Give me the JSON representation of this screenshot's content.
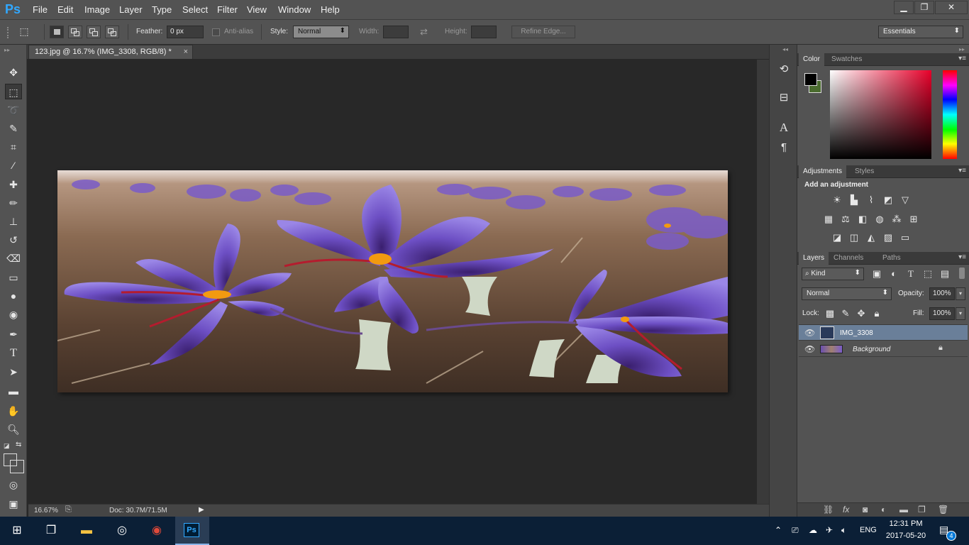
{
  "app": {
    "logo": "Ps",
    "menus": [
      "File",
      "Edit",
      "Image",
      "Layer",
      "Type",
      "Select",
      "Filter",
      "View",
      "Window",
      "Help"
    ]
  },
  "options": {
    "feather_label": "Feather:",
    "feather_value": "0 px",
    "antialias_label": "Anti-alias",
    "style_label": "Style:",
    "style_value": "Normal",
    "width_label": "Width:",
    "height_label": "Height:",
    "refine_edge": "Refine Edge...",
    "workspace": "Essentials"
  },
  "document": {
    "tab_title": "123.jpg @ 16.7% (IMG_3308, RGB/8) *",
    "zoom": "16.67%",
    "doc_size": "Doc: 30.7M/71.5M"
  },
  "panels": {
    "color_tab": "Color",
    "swatches_tab": "Swatches",
    "adjustments_tab": "Adjustments",
    "styles_tab": "Styles",
    "add_adjustment": "Add an adjustment",
    "layers_tab": "Layers",
    "channels_tab": "Channels",
    "paths_tab": "Paths",
    "kind_filter": "Kind",
    "blend_mode": "Normal",
    "opacity_label": "Opacity:",
    "opacity_value": "100%",
    "lock_label": "Lock:",
    "fill_label": "Fill:",
    "fill_value": "100%",
    "layers": [
      {
        "name": "IMG_3308",
        "selected": true
      },
      {
        "name": "Background",
        "selected": false
      }
    ]
  },
  "colors": {
    "foreground": "#000000",
    "background": "#4a6b2e",
    "accent": "#31a8ff"
  },
  "taskbar": {
    "language": "ENG",
    "time": "12:31 PM",
    "date": "2017-05-20",
    "notifications": "4"
  }
}
